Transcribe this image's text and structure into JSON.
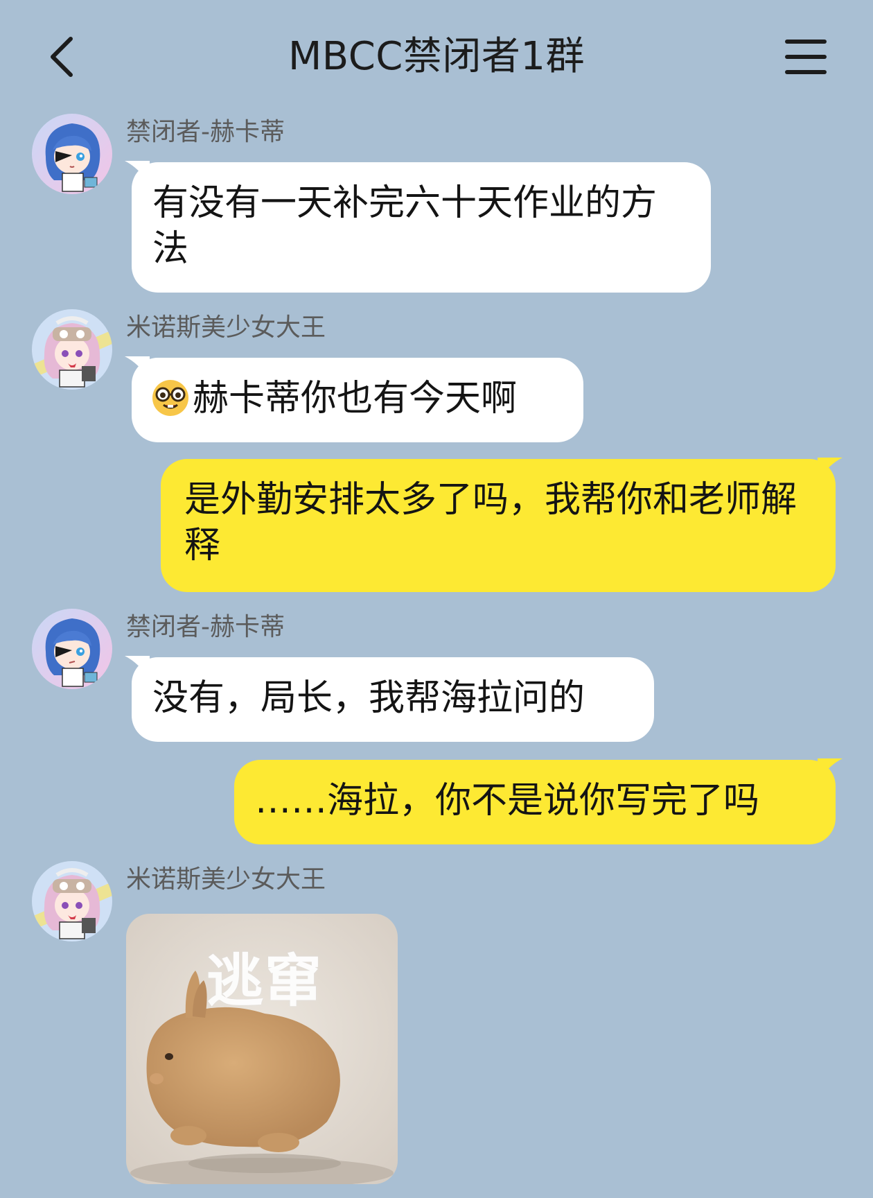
{
  "header": {
    "title": "MBCC禁闭者1群",
    "back_icon": "chevron-left-icon",
    "menu_icon": "hamburger-menu-icon"
  },
  "colors": {
    "background": "#a9bfd3",
    "incoming_bubble": "#ffffff",
    "outgoing_bubble": "#fde933"
  },
  "messages": [
    {
      "direction": "incoming",
      "sender": "禁闭者-赫卡蒂",
      "text": "有没有一天补完六十天作业的方法"
    },
    {
      "direction": "incoming",
      "sender": "米诺斯美少女大王",
      "emoji": "nerd-face-emoji",
      "text": "赫卡蒂你也有今天啊"
    },
    {
      "direction": "outgoing",
      "text": "是外勤安排太多了吗，我帮你和老师解释"
    },
    {
      "direction": "incoming",
      "sender": "禁闭者-赫卡蒂",
      "text": "没有，局长，我帮海拉问的"
    },
    {
      "direction": "outgoing",
      "text": "……海拉，你不是说你写完了吗"
    },
    {
      "direction": "incoming",
      "sender": "米诺斯美少女大王",
      "sticker_caption": "逃窜"
    }
  ]
}
